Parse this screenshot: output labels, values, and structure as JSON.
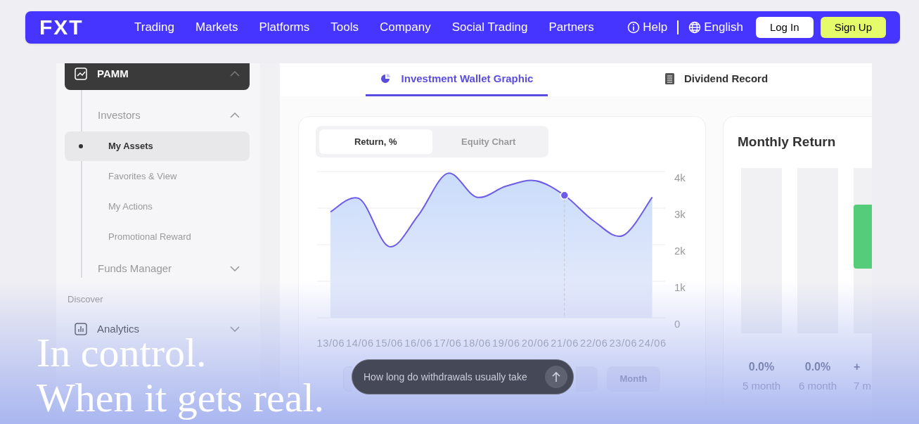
{
  "nav": {
    "logo": "FXT",
    "links": [
      "Trading",
      "Markets",
      "Platforms",
      "Tools",
      "Company",
      "Social Trading",
      "Partners"
    ],
    "help": "Help",
    "language": "English",
    "login": "Log In",
    "signup": "Sign Up"
  },
  "sidebar": {
    "items": [
      {
        "kind": "group",
        "label": "PAMM",
        "expanded": true,
        "children": [
          {
            "kind": "group",
            "label": "Investors",
            "expanded": true,
            "children": [
              {
                "kind": "link",
                "label": "My Assets",
                "selected": true
              },
              {
                "kind": "link",
                "label": "Favorites & View",
                "selected": false
              },
              {
                "kind": "link",
                "label": "My Actions",
                "selected": false
              },
              {
                "kind": "link",
                "label": "Promotional Reward",
                "selected": false
              }
            ]
          },
          {
            "kind": "group",
            "label": "Funds Manager",
            "expanded": false
          }
        ]
      },
      {
        "kind": "section",
        "label": "Discover"
      },
      {
        "kind": "group",
        "label": "Analytics",
        "expanded": false
      }
    ]
  },
  "tabs": [
    {
      "label": "Investment Wallet Graphic",
      "selected": true
    },
    {
      "label": "Dividend Record",
      "selected": false
    }
  ],
  "chart_toggle": [
    {
      "label": "Return, %",
      "selected": true
    },
    {
      "label": "Equity Chart",
      "selected": false
    }
  ],
  "chart_data": {
    "type": "area",
    "categories": [
      "13/06",
      "14/06",
      "15/06",
      "16/06",
      "17/06",
      "18/06",
      "19/06",
      "20/06",
      "21/06",
      "22/06",
      "23/06",
      "24/06"
    ],
    "series": [
      {
        "color": "#6c5ce7",
        "values": [
          2900,
          3250,
          1950,
          2800,
          3950,
          3300,
          3600,
          3750,
          3350,
          2650,
          2250,
          3300
        ]
      }
    ],
    "ylim": [
      0,
      4000
    ],
    "grid": true,
    "ref_lines": [
      {
        "axis": "x",
        "value": "21/06"
      }
    ],
    "yticks": [
      {
        "value": 0,
        "label": "0"
      },
      {
        "value": 1000,
        "label": "1k"
      },
      {
        "value": 2000,
        "label": "2k"
      },
      {
        "value": 3000,
        "label": "3k"
      },
      {
        "value": 4000,
        "label": "4k"
      }
    ]
  },
  "period_buttons": [
    "Month"
  ],
  "monthly_return": {
    "title": "Monthly Return",
    "columns": [
      {
        "value": "0.0%",
        "month": "5 month"
      },
      {
        "value": "0.0%",
        "month": "6 month"
      },
      {
        "value": "+",
        "month": "7 m",
        "level": 0.63
      }
    ]
  },
  "headline": [
    "In control.",
    "When it gets real."
  ],
  "chat": {
    "placeholder": "How long do withdrawals usually take"
  }
}
